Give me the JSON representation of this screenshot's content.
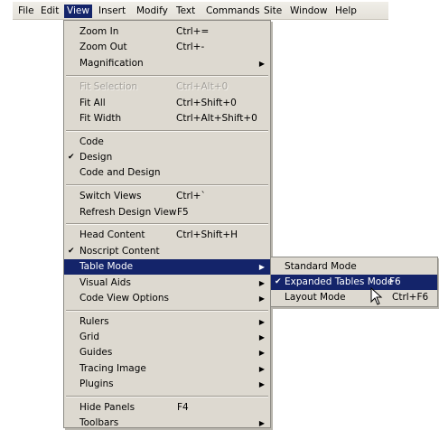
{
  "menubar": [
    "File",
    "Edit",
    "View",
    "Insert",
    "Modify",
    "Text",
    "Commands",
    "Site",
    "Window",
    "Help"
  ],
  "view_menu": [
    {
      "label": "Zoom In",
      "shortcut": "Ctrl+=",
      "arrow": false
    },
    {
      "label": "Zoom Out",
      "shortcut": "Ctrl+-",
      "arrow": false
    },
    {
      "label": "Magnification",
      "shortcut": "",
      "arrow": true
    },
    {
      "label": "Fit Selection",
      "shortcut": "Ctrl+Alt+0",
      "disabled": true
    },
    {
      "label": "Fit All",
      "shortcut": "Ctrl+Shift+0"
    },
    {
      "label": "Fit Width",
      "shortcut": "Ctrl+Alt+Shift+0"
    },
    {
      "label": "Code",
      "shortcut": ""
    },
    {
      "label": "Design",
      "shortcut": "",
      "checked": true
    },
    {
      "label": "Code and Design",
      "shortcut": ""
    },
    {
      "label": "Switch Views",
      "shortcut": "Ctrl+`"
    },
    {
      "label": "Refresh Design View",
      "shortcut": "F5"
    },
    {
      "label": "Head Content",
      "shortcut": "Ctrl+Shift+H"
    },
    {
      "label": "Noscript Content",
      "shortcut": "",
      "checked": true
    },
    {
      "label": "Table Mode",
      "shortcut": "",
      "arrow": true,
      "highlighted": true
    },
    {
      "label": "Visual Aids",
      "shortcut": "",
      "arrow": true
    },
    {
      "label": "Code View Options",
      "shortcut": "",
      "arrow": true
    },
    {
      "label": "Rulers",
      "shortcut": "",
      "arrow": true
    },
    {
      "label": "Grid",
      "shortcut": "",
      "arrow": true
    },
    {
      "label": "Guides",
      "shortcut": "",
      "arrow": true
    },
    {
      "label": "Tracing Image",
      "shortcut": "",
      "arrow": true
    },
    {
      "label": "Plugins",
      "shortcut": "",
      "arrow": true
    },
    {
      "label": "Hide Panels",
      "shortcut": "F4"
    },
    {
      "label": "Toolbars",
      "shortcut": "",
      "arrow": true
    }
  ],
  "table_mode_submenu": [
    {
      "label": "Standard Mode",
      "shortcut": ""
    },
    {
      "label": "Expanded Tables Mode",
      "shortcut": "F6",
      "checked": true,
      "highlighted": true
    },
    {
      "label": "Layout Mode",
      "shortcut": "Ctrl+F6"
    }
  ],
  "glyphs": {
    "check": "✔",
    "arrow": "▶"
  },
  "colors": {
    "menu_bg": "#ddd9d0",
    "highlight": "#14246a",
    "disabled_text": "#a3a09a"
  }
}
